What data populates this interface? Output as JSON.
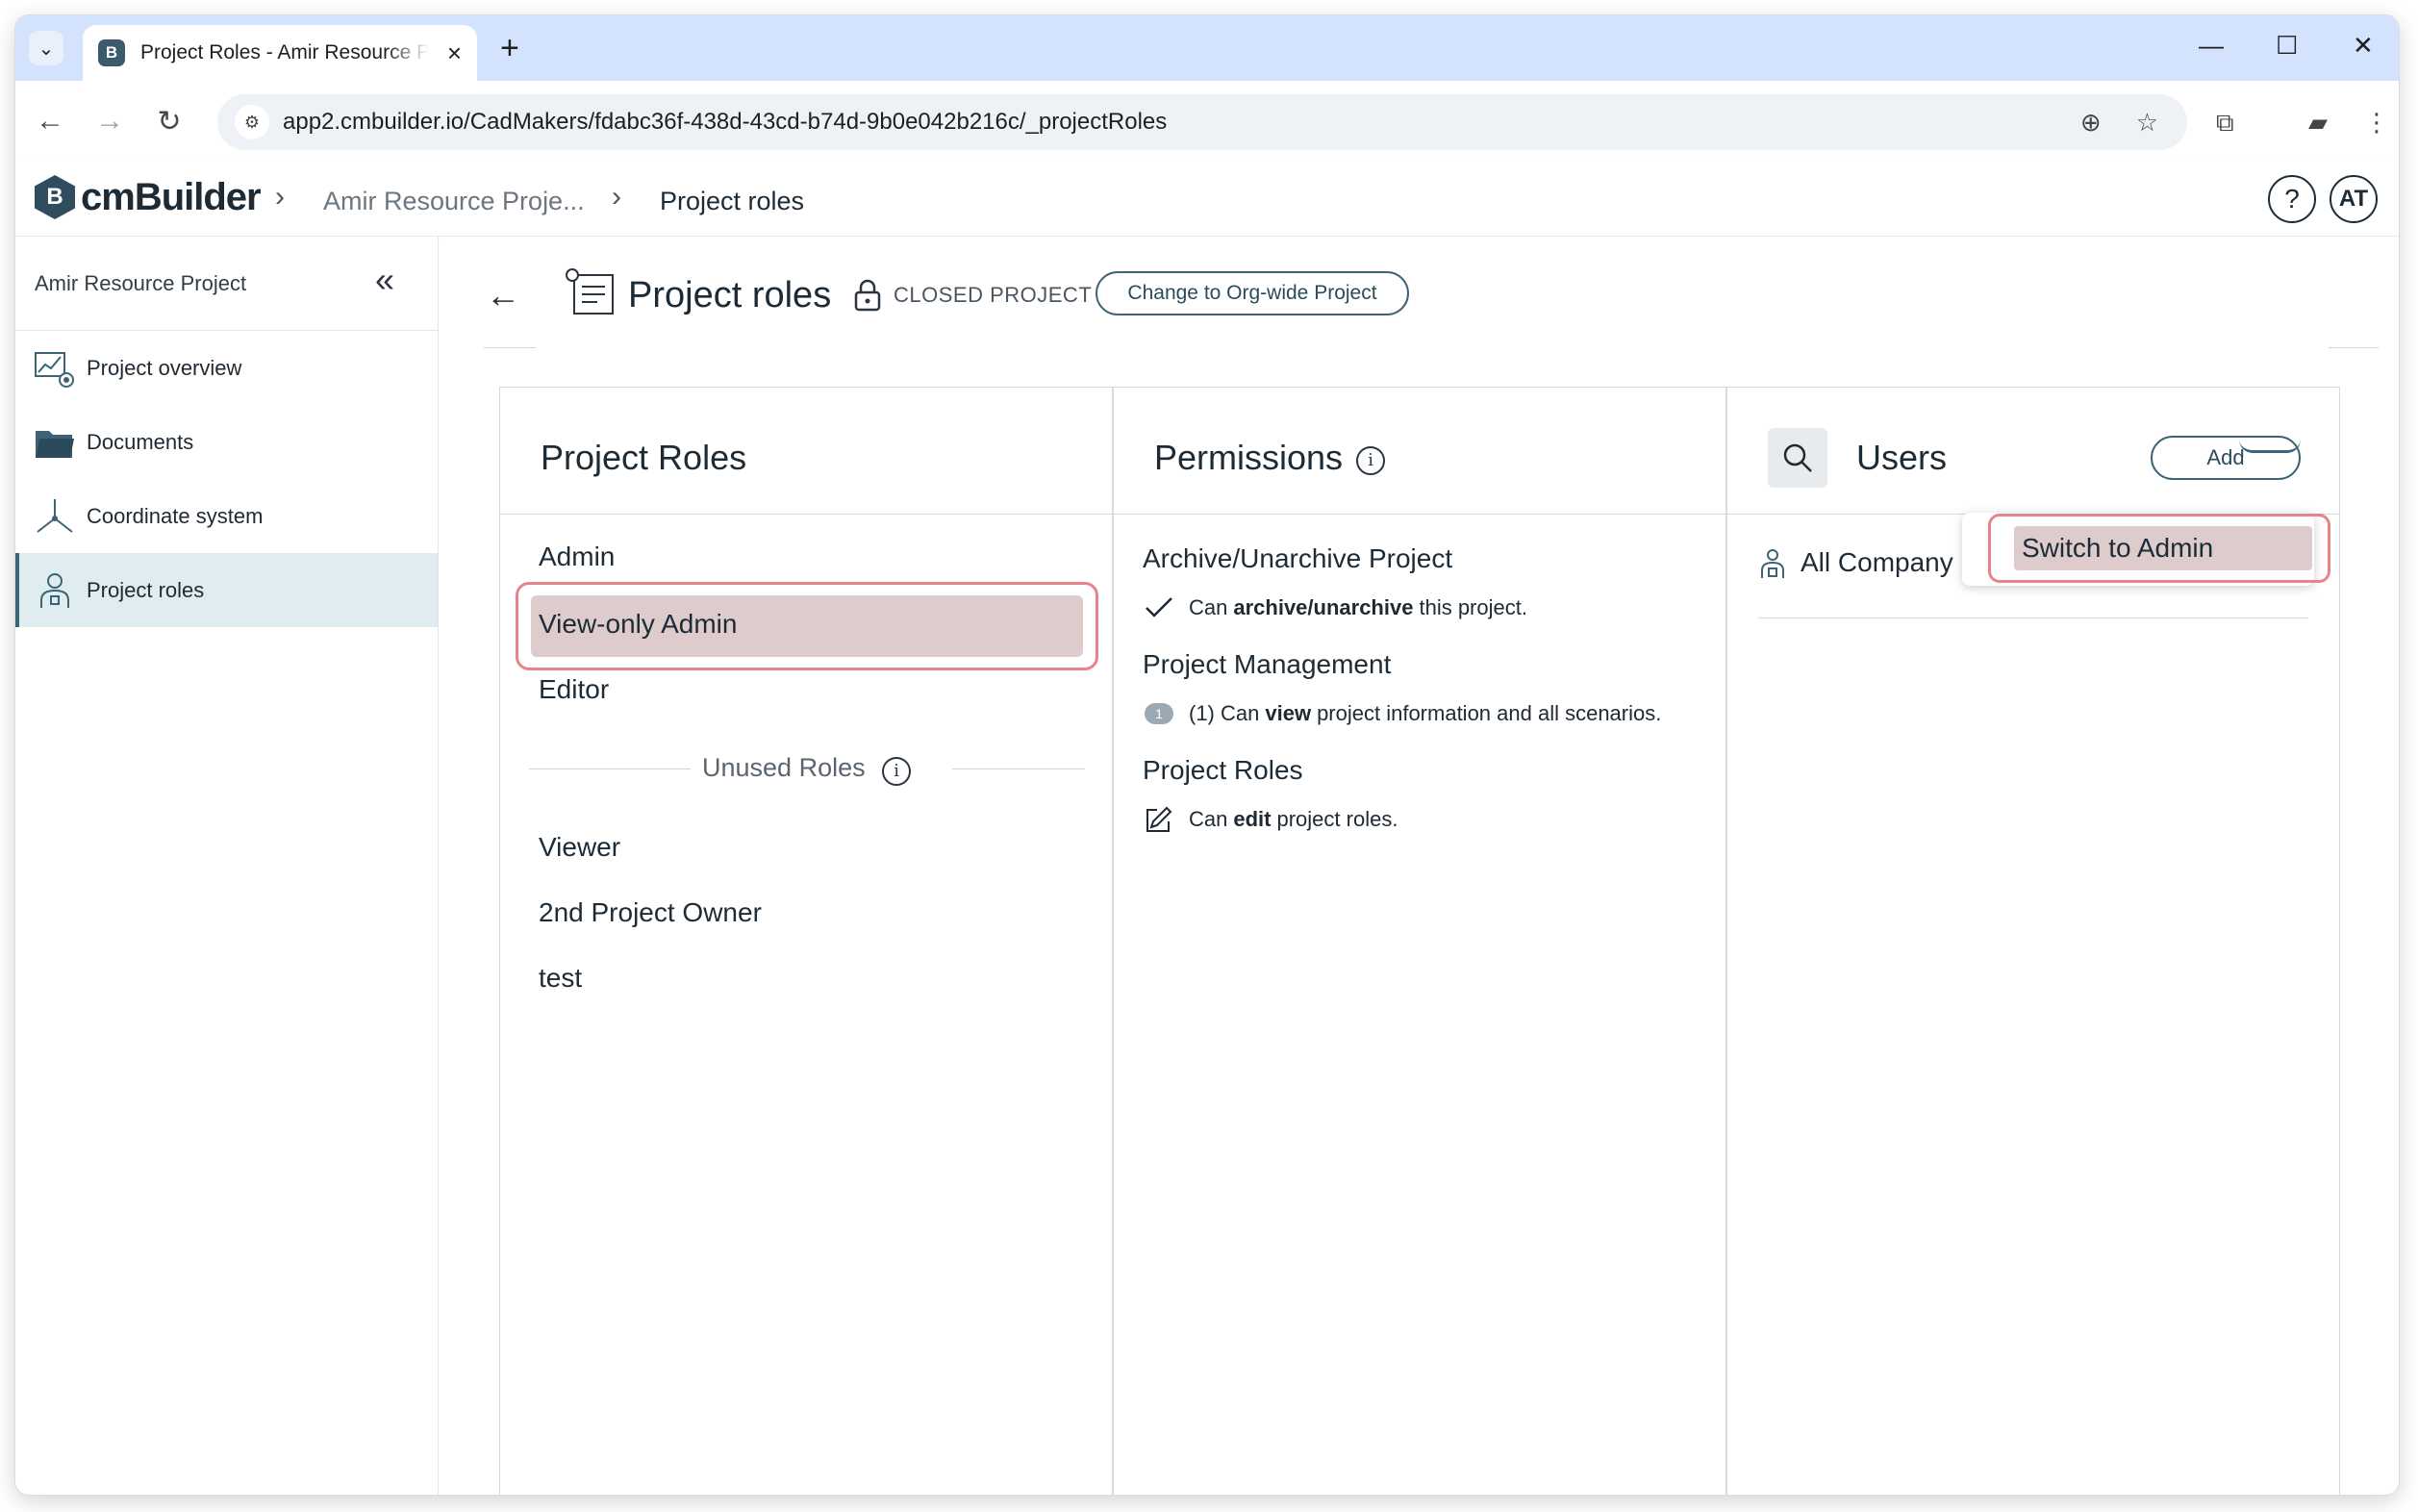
{
  "browser": {
    "tab_title": "Project Roles - Amir Resource Project",
    "tab_favicon": "B",
    "url": "app2.cmbuilder.io/CadMakers/fdabc36f-438d-43cd-b74d-9b0e042b216c/_projectRoles"
  },
  "app": {
    "logo_mark": "B",
    "logo_text": "cmBuilder",
    "breadcrumb": [
      "Amir Resource Proje...",
      "Project roles"
    ],
    "help_label": "?",
    "avatar_initials": "AT"
  },
  "sidebar": {
    "project_name": "Amir Resource Project",
    "items": [
      {
        "label": "Project overview",
        "icon": "project-overview-icon"
      },
      {
        "label": "Documents",
        "icon": "folder-icon"
      },
      {
        "label": "Coordinate system",
        "icon": "axes-icon"
      },
      {
        "label": "Project roles",
        "icon": "user-badge-icon",
        "active": true
      }
    ]
  },
  "page": {
    "title": "Project roles",
    "status": "CLOSED PROJECT",
    "change_button": "Change to Org-wide Project"
  },
  "roles_panel": {
    "title": "Project Roles",
    "roles": [
      "Admin",
      "View-only Admin",
      "Editor"
    ],
    "selected_role": "View-only Admin",
    "unused_label": "Unused Roles",
    "unused_roles": [
      "Viewer",
      "2nd Project Owner",
      "test"
    ]
  },
  "permissions_panel": {
    "title": "Permissions",
    "groups": [
      {
        "heading": "Archive/Unarchive Project",
        "pre": "Can",
        "bold": "archive/unarchive",
        "post": "this project.",
        "icon": "check-icon"
      },
      {
        "heading": "Project Management",
        "badge": "1",
        "pre": "(1) Can",
        "bold": "view",
        "post": "project information and all scenarios.",
        "icon": "count-badge-icon"
      },
      {
        "heading": "Project Roles",
        "pre": "Can",
        "bold": "edit",
        "post": "project roles.",
        "icon": "edit-icon"
      }
    ]
  },
  "users_panel": {
    "title": "Users",
    "add_button": "Add",
    "users": [
      {
        "name": "All Company"
      }
    ],
    "popup_option": "Switch to Admin"
  },
  "colors": {
    "accent": "#3d6377",
    "selection": "#decbcc",
    "highlight_outline": "#e8838a",
    "sidebar_active": "#dfecf0"
  }
}
